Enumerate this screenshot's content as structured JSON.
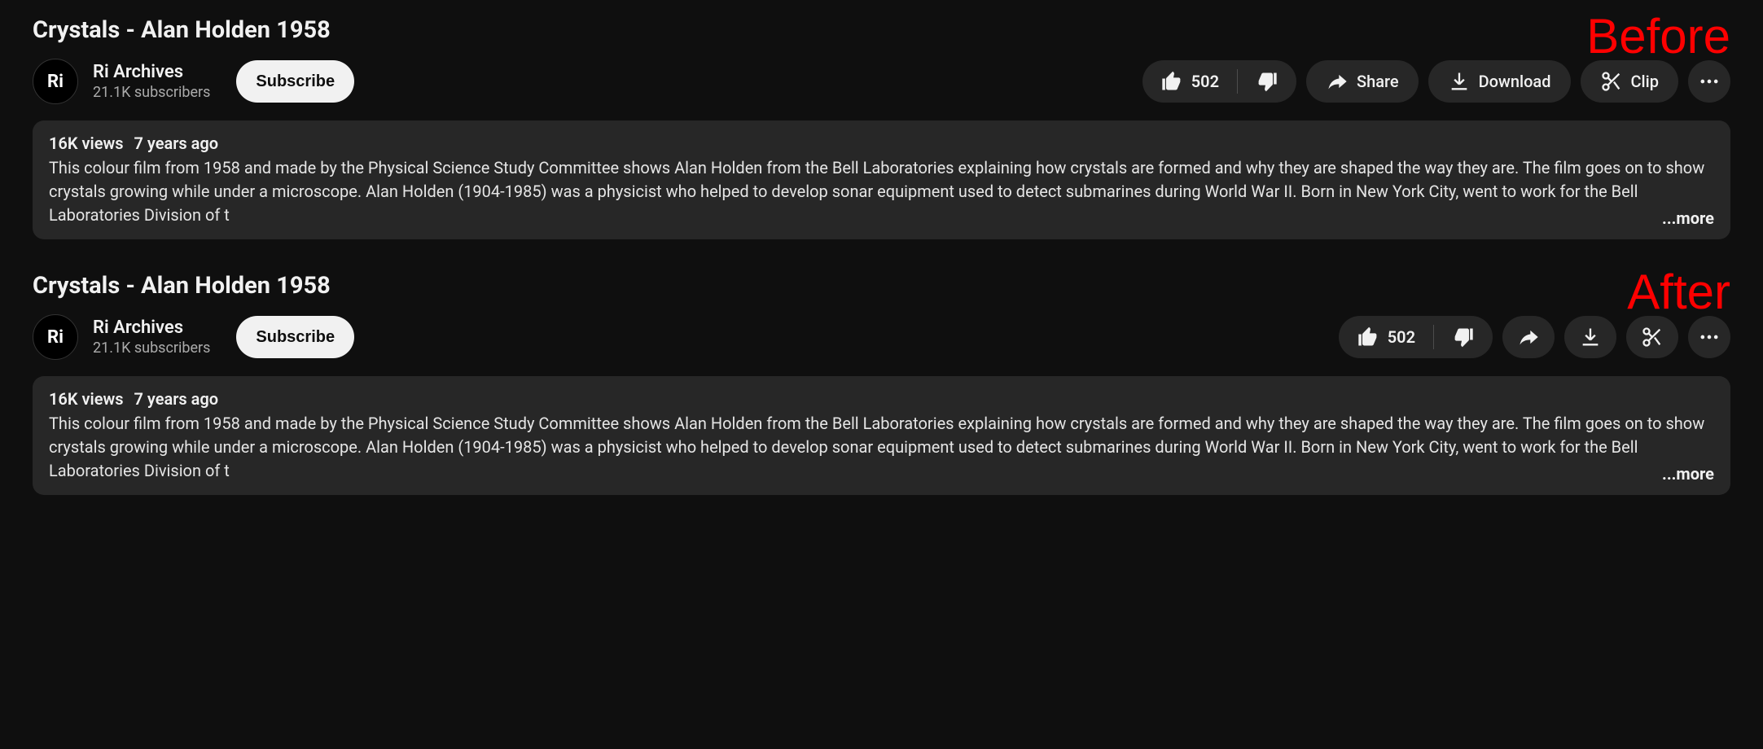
{
  "labels": {
    "before": "Before",
    "after": "After"
  },
  "video": {
    "title": "Crystals - Alan Holden 1958"
  },
  "channel": {
    "avatar_text": "Ri",
    "name": "Ri Archives",
    "subscribers": "21.1K subscribers"
  },
  "subscribe": {
    "label": "Subscribe"
  },
  "actions": {
    "like_count": "502",
    "share": "Share",
    "download": "Download",
    "clip": "Clip"
  },
  "description": {
    "views": "16K views",
    "age": "7 years ago",
    "text": "This colour film from 1958 and made by the Physical Science Study Committee shows Alan Holden from the Bell Laboratories explaining how crystals are formed and why they are shaped the way they are. The film goes on to show crystals growing while under a microscope. Alan Holden (1904-1985) was a physicist who helped to develop sonar equipment used to detect submarines during World War II. Born in New York City, went to work for the Bell Laboratories Division of t",
    "more": "...more"
  }
}
